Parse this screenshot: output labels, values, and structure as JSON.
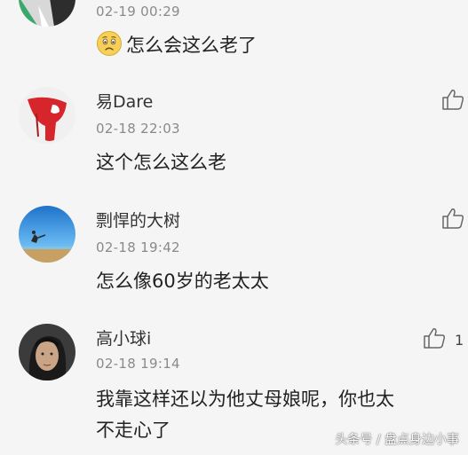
{
  "comments": [
    {
      "username": "",
      "timestamp": "02-19 00:29",
      "text": "怎么会这么老了",
      "emoji_icon": "crying-face-emoji-icon"
    },
    {
      "username": "易Dare",
      "timestamp": "02-18 22:03",
      "text": "这个怎么这么老",
      "like_icon": "thumbs-up-icon"
    },
    {
      "username": "剽悍的大树",
      "timestamp": "02-18 19:42",
      "text": "怎么像60岁的老太太",
      "like_icon": "thumbs-up-icon"
    },
    {
      "username": "高小球i",
      "timestamp": "02-18 19:14",
      "text_lines": [
        "我靠这样还以为他丈母娘呢，你也太",
        "不走心了"
      ],
      "like_icon": "thumbs-up-icon",
      "like_count": "1"
    }
  ],
  "watermark": "头条号 / 盘点身边小事",
  "colors": {
    "background": "#f5f5f5",
    "divider": "#e3e3e3",
    "username": "#333333",
    "timestamp": "#8a8a8a",
    "text": "#222222"
  }
}
